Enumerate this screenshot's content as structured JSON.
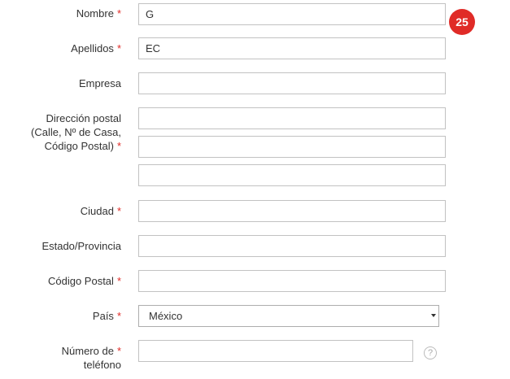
{
  "badge": "25",
  "fields": {
    "nombre": {
      "label": "Nombre",
      "value": "G"
    },
    "apellidos": {
      "label": "Apellidos",
      "value": "EC"
    },
    "empresa": {
      "label": "Empresa",
      "value": ""
    },
    "direccion": {
      "label_line1": "Dirección postal",
      "label_line2": "(Calle, Nº de Casa,",
      "label_line3": "Código Postal)",
      "value1": "",
      "value2": "",
      "value3": ""
    },
    "ciudad": {
      "label": "Ciudad",
      "value": ""
    },
    "estado": {
      "label": "Estado/Provincia",
      "value": ""
    },
    "codigo_postal": {
      "label": "Código Postal",
      "value": ""
    },
    "pais": {
      "label": "País",
      "value": "México"
    },
    "telefono": {
      "label_line1": "Número de",
      "label_line2": "teléfono",
      "value": ""
    }
  },
  "required_marker": "*",
  "help_symbol": "?",
  "colors": {
    "required": "#e02b27",
    "badge": "#e02b27"
  }
}
